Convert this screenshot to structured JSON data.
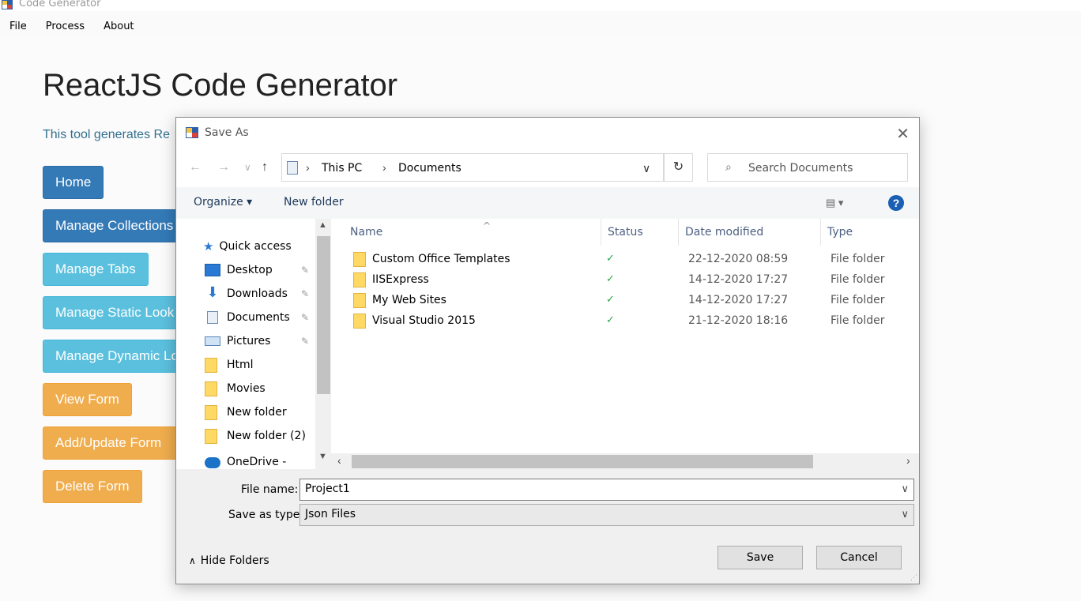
{
  "window": {
    "title": "Code Generator"
  },
  "menu": [
    "File",
    "Process",
    "About"
  ],
  "page": {
    "title": "ReactJS Code Generator",
    "subtitle": "This tool generates Re",
    "buttons": [
      {
        "label": "Home",
        "style": "primary"
      },
      {
        "label": "Manage Collections",
        "style": "primary"
      },
      {
        "label": "Manage Tabs",
        "style": "info"
      },
      {
        "label": "Manage Static Look",
        "style": "info"
      },
      {
        "label": "Manage Dynamic Lo",
        "style": "info"
      },
      {
        "label": "View Form",
        "style": "warning"
      },
      {
        "label": "Add/Update Form",
        "style": "warning"
      },
      {
        "label": "Delete Form",
        "style": "warning"
      }
    ]
  },
  "dialog": {
    "title": "Save As",
    "close": "✕",
    "nav": {
      "back": "←",
      "forward": "→",
      "recent": "∨",
      "up": "↑"
    },
    "address": [
      "This PC",
      "Documents"
    ],
    "search_placeholder": "Search Documents",
    "toolbar": {
      "organize": "Organize ▾",
      "new_folder": "New folder",
      "help": "?"
    },
    "nav_pane": {
      "quick_access": "Quick access",
      "items": [
        {
          "label": "Desktop",
          "icon": "desktop-icon",
          "pinned": true
        },
        {
          "label": "Downloads",
          "icon": "download-arrow-icon",
          "pinned": true
        },
        {
          "label": "Documents",
          "icon": "document-icon",
          "pinned": true
        },
        {
          "label": "Pictures",
          "icon": "picture-icon",
          "pinned": true
        },
        {
          "label": "Html",
          "icon": "folder-icon",
          "pinned": false
        },
        {
          "label": "Movies",
          "icon": "folder-icon",
          "pinned": false
        },
        {
          "label": "New folder",
          "icon": "folder-icon",
          "pinned": false
        },
        {
          "label": "New folder (2)",
          "icon": "folder-icon",
          "pinned": false
        }
      ],
      "partial_item": "OneDrive - Applic"
    },
    "columns": [
      "Name",
      "Status",
      "Date modified",
      "Type"
    ],
    "files": [
      {
        "name": "Custom Office Templates",
        "status": "✓",
        "date": "22-12-2020 08:59",
        "type": "File folder"
      },
      {
        "name": "IISExpress",
        "status": "✓",
        "date": "14-12-2020 17:27",
        "type": "File folder"
      },
      {
        "name": "My Web Sites",
        "status": "✓",
        "date": "14-12-2020 17:27",
        "type": "File folder"
      },
      {
        "name": "Visual Studio 2015",
        "status": "✓",
        "date": "21-12-2020 18:16",
        "type": "File folder"
      }
    ],
    "file_name_label": "File name:",
    "file_name_value": "Project1",
    "save_type_label": "Save as type:",
    "save_type_value": "Json Files",
    "hide_folders": "Hide Folders",
    "save": "Save",
    "cancel": "Cancel"
  },
  "colors": {
    "primary": "#337ab7",
    "info": "#5bc0de",
    "warning": "#f0ad4e",
    "link_blue": "#1e395b",
    "status_ok": "#2aa745"
  }
}
